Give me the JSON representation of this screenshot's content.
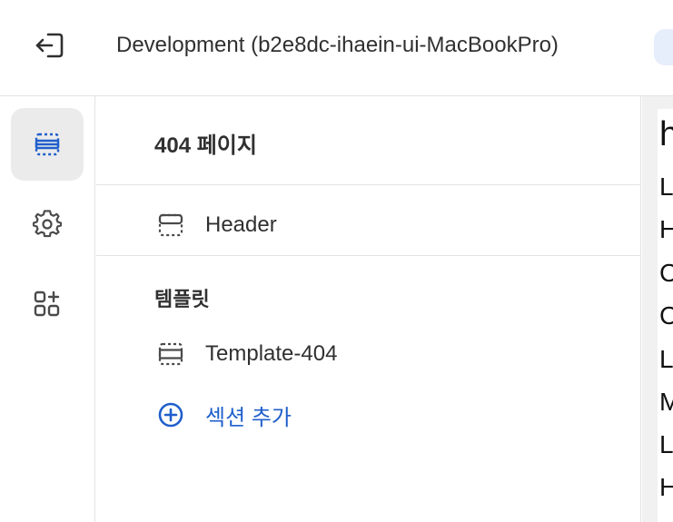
{
  "topbar": {
    "exit_icon": "exit-icon",
    "title": "Development (b2e8dc-ihaein-ui-MacBookPro)"
  },
  "rail": {
    "items": [
      {
        "icon": "sections-icon",
        "active": true
      },
      {
        "icon": "settings-gear-icon",
        "active": false
      },
      {
        "icon": "apps-add-icon",
        "active": false
      }
    ]
  },
  "panel": {
    "title": "404 페이지",
    "header_section": {
      "label": "Header",
      "icon": "section-icon"
    },
    "template_group_label": "템플릿",
    "template_section": {
      "label": "Template-404",
      "icon": "section-icon"
    },
    "add_section": {
      "label": "섹션 추가",
      "icon": "plus-circle-icon"
    }
  },
  "preview": {
    "heading_char": "h",
    "line_chars": [
      "L",
      "H",
      "C",
      "C",
      "L",
      "M",
      "L",
      "H"
    ]
  },
  "colors": {
    "accent_blue": "#1f5fcc",
    "text_primary": "#303030",
    "rail_active_bg": "#ebebeb"
  }
}
